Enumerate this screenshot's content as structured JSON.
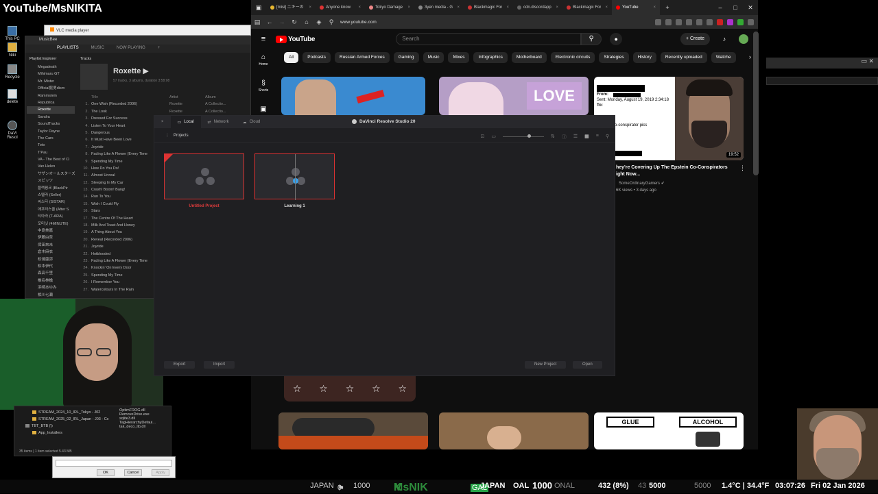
{
  "overlay": {
    "title": "YouTube/MsNIKITA"
  },
  "desktop": {
    "icons": [
      "This PC",
      "Niki",
      "Recycle",
      "delete",
      "DaVi Resol"
    ]
  },
  "vlc": {
    "title": "VLC media player"
  },
  "musicbee": {
    "app_title": "MusicBee",
    "tabs": [
      "PLAYLISTS",
      "MUSIC",
      "NOW PLAYING",
      "+"
    ],
    "explorer_header": "Playlist Explorer",
    "playlists": [
      "Megadeath",
      "Mihimaru GT",
      "Mr. Mister",
      "Official髭男dism",
      "Rammstein",
      "Republica",
      "Roxette",
      "Sandra",
      "SoundTracks",
      "Taylor Dayne",
      "The Cars",
      "Toto",
      "T'Pau",
      "VA - The Best of Ci",
      "Van Helen",
      "サザンオールスターズ",
      "スピッツ",
      "블랙핑크 (BlackPir",
      "스텔라 (Seller)",
      "씨스타 (SISTAR)",
      "애프터스쿨 (After S",
      "티아라 (T-ARA)",
      "포미닛 (4MINUTE)",
      "中島美嘉",
      "伊藤由奈",
      "倖田來未",
      "倉木麻衣",
      "松浦亜弥",
      "松本伊代",
      "森高千里",
      "椎名林檎",
      "浜崎あゆみ",
      "相川七瀬"
    ],
    "selected_playlist": "Roxette",
    "tracks_header": "Tracks",
    "artist": "Roxette",
    "artist_sub": "57 tracks, 3 albums, duration 3:58:08",
    "columns": [
      "Title",
      "Artist",
      "Album"
    ],
    "tracks": [
      {
        "n": "1.",
        "title": "One Wish (Recorded 2006)",
        "artist": "Roxette",
        "album": "A Collectio..."
      },
      {
        "n": "2.",
        "title": "The Look",
        "artist": "Roxette",
        "album": "A Collectio..."
      },
      {
        "n": "3.",
        "title": "Dressed For Success",
        "artist": "",
        "album": ""
      },
      {
        "n": "4.",
        "title": "Listen To Your Heart",
        "artist": "",
        "album": ""
      },
      {
        "n": "5.",
        "title": "Dangerous",
        "artist": "",
        "album": ""
      },
      {
        "n": "6.",
        "title": "It Must Have Been Love",
        "artist": "",
        "album": ""
      },
      {
        "n": "7.",
        "title": "Joyride",
        "artist": "",
        "album": ""
      },
      {
        "n": "8.",
        "title": "Fading Like A Flower (Every Time",
        "artist": "",
        "album": ""
      },
      {
        "n": "9.",
        "title": "Spending My Time",
        "artist": "",
        "album": ""
      },
      {
        "n": "10.",
        "title": "How Do You Do!",
        "artist": "",
        "album": ""
      },
      {
        "n": "11.",
        "title": "Almost Unreal",
        "artist": "",
        "album": ""
      },
      {
        "n": "12.",
        "title": "Sleeping In My Car",
        "artist": "",
        "album": ""
      },
      {
        "n": "13.",
        "title": "Crash! Boom! Bang!",
        "artist": "",
        "album": ""
      },
      {
        "n": "14.",
        "title": "Run To You",
        "artist": "",
        "album": ""
      },
      {
        "n": "15.",
        "title": "Wish I Could Fly",
        "artist": "",
        "album": ""
      },
      {
        "n": "16.",
        "title": "Stars",
        "artist": "",
        "album": ""
      },
      {
        "n": "17.",
        "title": "The Centre Of The Heart",
        "artist": "",
        "album": ""
      },
      {
        "n": "18.",
        "title": "Milk And Toast And Honey",
        "artist": "",
        "album": ""
      },
      {
        "n": "19.",
        "title": "A Thing About You",
        "artist": "",
        "album": ""
      },
      {
        "n": "20.",
        "title": "Reveal (Recorded 2006)",
        "artist": "",
        "album": ""
      },
      {
        "n": "21.",
        "title": "Joyride",
        "artist": "",
        "album": ""
      },
      {
        "n": "22.",
        "title": "Hotblooded",
        "artist": "",
        "album": ""
      },
      {
        "n": "23.",
        "title": "Fading Like A Flower (Every Time",
        "artist": "",
        "album": ""
      },
      {
        "n": "24.",
        "title": "Knockin' On Every Door",
        "artist": "",
        "album": ""
      },
      {
        "n": "25.",
        "title": "Spending My Time",
        "artist": "",
        "album": ""
      },
      {
        "n": "26.",
        "title": "I Remember You",
        "artist": "",
        "album": ""
      },
      {
        "n": "27.",
        "title": "Watercolours In The Rain",
        "artist": "",
        "album": ""
      }
    ]
  },
  "explorer": {
    "folders": [
      "STREAM_2024_10_IRL_Tokyo - J02",
      "STREAM_2025_02_IRL_Japan - J03 - Cx",
      "TBT_BTB (\\)",
      "App_Installers"
    ],
    "files": [
      "OptimFROG.dll",
      "RemoveDrive.exe",
      "sqlite3.dll",
      "TagHierarchyDefaul...",
      "tak_deco_lib.dll"
    ],
    "status": "35 items | 1 item selected 5.43 MB"
  },
  "dialog": {
    "ok": "OK",
    "cancel": "Cancel",
    "apply": "Apply"
  },
  "browser": {
    "tabs": [
      "[misi] ニキーの",
      "Anyone know",
      "Tokyo Damage Rep",
      "3yen media - G",
      "Blackmagic For",
      "cdn.discordapp.com",
      "Blackmagic For",
      "YouTube"
    ],
    "url": "www.youtube.com"
  },
  "youtube": {
    "logo": "YouTube",
    "search_placeholder": "Search",
    "create": "Create",
    "sidebar": [
      "Home",
      "Shorts"
    ],
    "chips": [
      "All",
      "Podcasts",
      "Russian Armed Forces",
      "Gaming",
      "Music",
      "Mixes",
      "Infographics",
      "Motherboard",
      "Electronic circuits",
      "Strategies",
      "History",
      "Recently uploaded",
      "Watche"
    ],
    "selected_chip": "All",
    "video": {
      "title_line1": "hey're Covering Up The Epstein Co-Conspirators",
      "title_line2": "ight Now...",
      "channel": "SomeOrdinaryGamers",
      "meta": "6K views • 3 days ago",
      "duration": "19:52",
      "email_from": "From:",
      "email_sent": "Sent: Monday, August 19, 2019 2:34:18",
      "email_to": "To:",
      "email_subject": "Epstein Co-conspirator pics",
      "email_ve": "ve"
    },
    "love_text": "LOVE",
    "glue": "GLUE",
    "alcohol": "ALCOHOL"
  },
  "davinci": {
    "title": "DaVinci Resolve Studio 20",
    "tabs": [
      "Local",
      "Network",
      "Cloud"
    ],
    "section": "Projects",
    "projects": [
      {
        "name": "Untitled Project",
        "color": "#e03c3c"
      },
      {
        "name": "Learning 1",
        "color": "#dddddd"
      }
    ],
    "buttons": {
      "export": "Export",
      "import": "Import",
      "new_project": "New Project",
      "open": "Open"
    }
  },
  "bottom_bar": {
    "japan": "JAPAN",
    "japan_val": "0",
    "j1000": "1000",
    "brand": "MsNIK",
    "gal_tag": "GAL",
    "japan2": "JAPAN",
    "gal_tail": "OAL",
    "big1000": "1000",
    "cap_tail": "ONAL",
    "stats": "432 (8%)",
    "stats2": "43",
    "val5000": "5000",
    "val5000b": "5000",
    "temp": "1.4°C | 34.4°F",
    "time": "03:07:26",
    "date": "Fri 02 Jan 2026"
  },
  "colors": {
    "yt_bg": "#0f0f0f",
    "davinci_red": "#dd3333",
    "musicbee_bg": "#1e1e1e",
    "brand_green": "#2d8b3b"
  }
}
